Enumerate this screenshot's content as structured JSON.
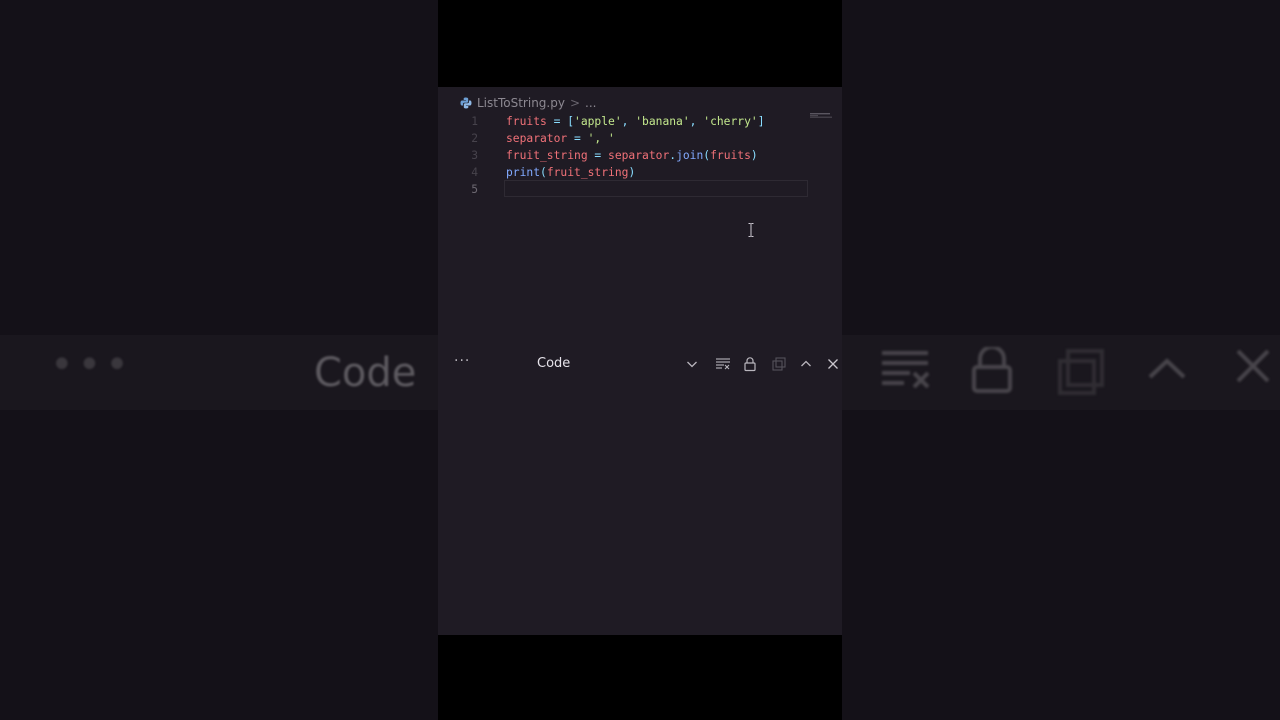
{
  "background": {
    "left_label_dots": "•••",
    "left_label_code": "Code"
  },
  "editor": {
    "breadcrumb": {
      "file": "ListToString.py",
      "separator": ">",
      "more": "..."
    },
    "lines": [
      {
        "number": "1",
        "tokens": [
          {
            "t": "var",
            "v": "fruits"
          },
          {
            "t": "op",
            "v": " = "
          },
          {
            "t": "punc",
            "v": "["
          },
          {
            "t": "str",
            "v": "'apple'"
          },
          {
            "t": "punc",
            "v": ", "
          },
          {
            "t": "str",
            "v": "'banana'"
          },
          {
            "t": "punc",
            "v": ", "
          },
          {
            "t": "str",
            "v": "'cherry'"
          },
          {
            "t": "punc",
            "v": "]"
          }
        ]
      },
      {
        "number": "2",
        "tokens": [
          {
            "t": "var",
            "v": "separator"
          },
          {
            "t": "op",
            "v": " = "
          },
          {
            "t": "str",
            "v": "', '"
          }
        ]
      },
      {
        "number": "3",
        "tokens": [
          {
            "t": "var",
            "v": "fruit_string"
          },
          {
            "t": "op",
            "v": " = "
          },
          {
            "t": "var",
            "v": "separator"
          },
          {
            "t": "punc",
            "v": "."
          },
          {
            "t": "fn",
            "v": "join"
          },
          {
            "t": "punc",
            "v": "("
          },
          {
            "t": "var",
            "v": "fruits"
          },
          {
            "t": "punc",
            "v": ")"
          }
        ]
      },
      {
        "number": "4",
        "tokens": [
          {
            "t": "fn",
            "v": "print"
          },
          {
            "t": "punc",
            "v": "("
          },
          {
            "t": "var",
            "v": "fruit_string"
          },
          {
            "t": "punc",
            "v": ")"
          }
        ]
      },
      {
        "number": "5",
        "tokens": []
      }
    ]
  },
  "panel": {
    "more_label": "···",
    "title": "Code",
    "icons": [
      "chevron-down-icon",
      "clear-output-icon",
      "lock-icon",
      "copy-icon",
      "chevron-up-icon",
      "close-icon"
    ]
  },
  "colors": {
    "editor_bg": "#1f1b24",
    "string": "#c3e88d",
    "variable": "#f07178",
    "function": "#82aaff",
    "operator": "#89ddff"
  }
}
